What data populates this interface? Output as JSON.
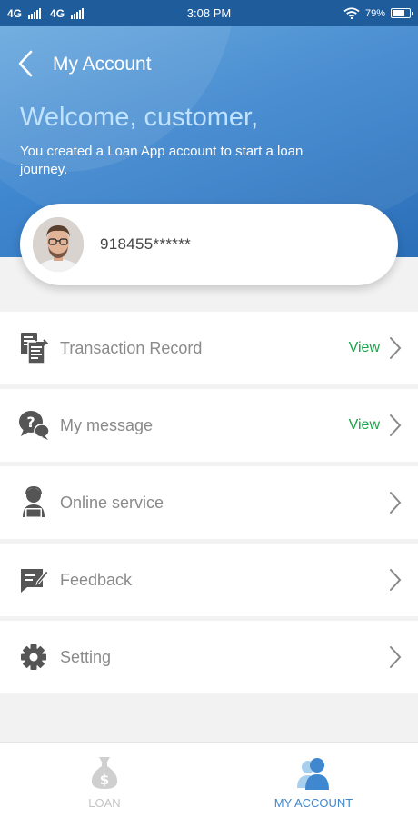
{
  "status_bar": {
    "network_1": "4G",
    "network_2": "4G",
    "time": "3:08 PM",
    "battery": "79%",
    "battery_level": 0.79
  },
  "header": {
    "title": "My Account",
    "welcome": "Welcome, customer,",
    "subtitle": "You created a Loan App account to start a loan journey."
  },
  "account": {
    "number": "918455******"
  },
  "menu": {
    "items": [
      {
        "label": "Transaction Record",
        "action": "View",
        "icon": "document-list-icon"
      },
      {
        "label": "My message",
        "action": "View",
        "icon": "chat-question-icon"
      },
      {
        "label": "Online service",
        "action": "",
        "icon": "customer-service-icon"
      },
      {
        "label": "Feedback",
        "action": "",
        "icon": "feedback-edit-icon"
      },
      {
        "label": "Setting",
        "action": "",
        "icon": "gear-icon"
      }
    ]
  },
  "tabs": [
    {
      "label": "LOAN",
      "icon": "money-bag-icon",
      "active": false
    },
    {
      "label": "MY ACCOUNT",
      "icon": "users-icon",
      "active": true
    }
  ],
  "colors": {
    "header_blue": "#3f87cf",
    "view_green": "#1aa34a",
    "active_tab": "#3f87cf",
    "welcome_text": "#bfe3ff"
  }
}
